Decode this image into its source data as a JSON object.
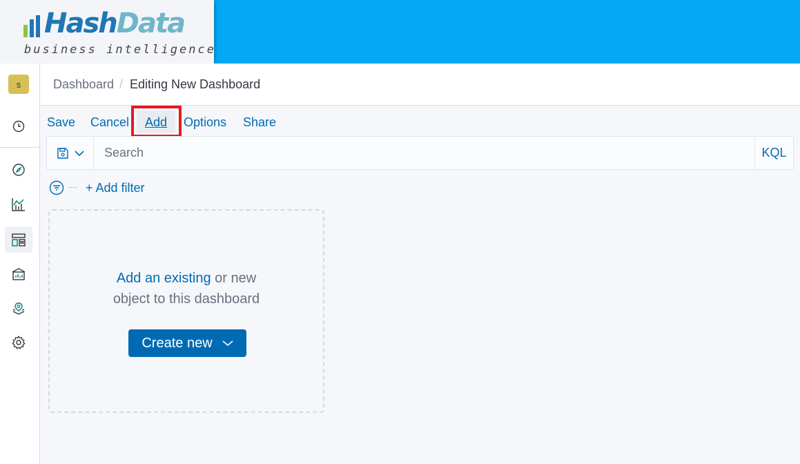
{
  "brand": {
    "name_part1": "Hash",
    "name_part2": "Data",
    "tagline": "business intelligence",
    "banner_color": "#03a9f4"
  },
  "user": {
    "avatar_initial": "s",
    "avatar_color": "#d6bf57"
  },
  "nav": {
    "items": [
      {
        "icon": "clock-icon",
        "label": "Recently viewed"
      },
      {
        "icon": "compass-icon",
        "label": "Discover"
      },
      {
        "icon": "visualize-icon",
        "label": "Visualize"
      },
      {
        "icon": "dashboard-icon",
        "label": "Dashboard",
        "active": true
      },
      {
        "icon": "canvas-icon",
        "label": "Canvas"
      },
      {
        "icon": "maps-icon",
        "label": "Maps"
      },
      {
        "icon": "gear-icon",
        "label": "Management"
      }
    ]
  },
  "breadcrumb": {
    "parent": "Dashboard",
    "separator": "/",
    "current": "Editing New Dashboard"
  },
  "top_menu": {
    "save": "Save",
    "cancel": "Cancel",
    "add": "Add",
    "options": "Options",
    "share": "Share"
  },
  "query": {
    "placeholder": "Search",
    "language": "KQL"
  },
  "filter": {
    "add_label": "+ Add filter"
  },
  "empty_state": {
    "link_text": "Add an existing",
    "text_after_link": " or new",
    "line2": "object to this dashboard",
    "button_label": "Create new"
  },
  "colors": {
    "link": "#006bb4",
    "highlight": "#e8191f"
  }
}
